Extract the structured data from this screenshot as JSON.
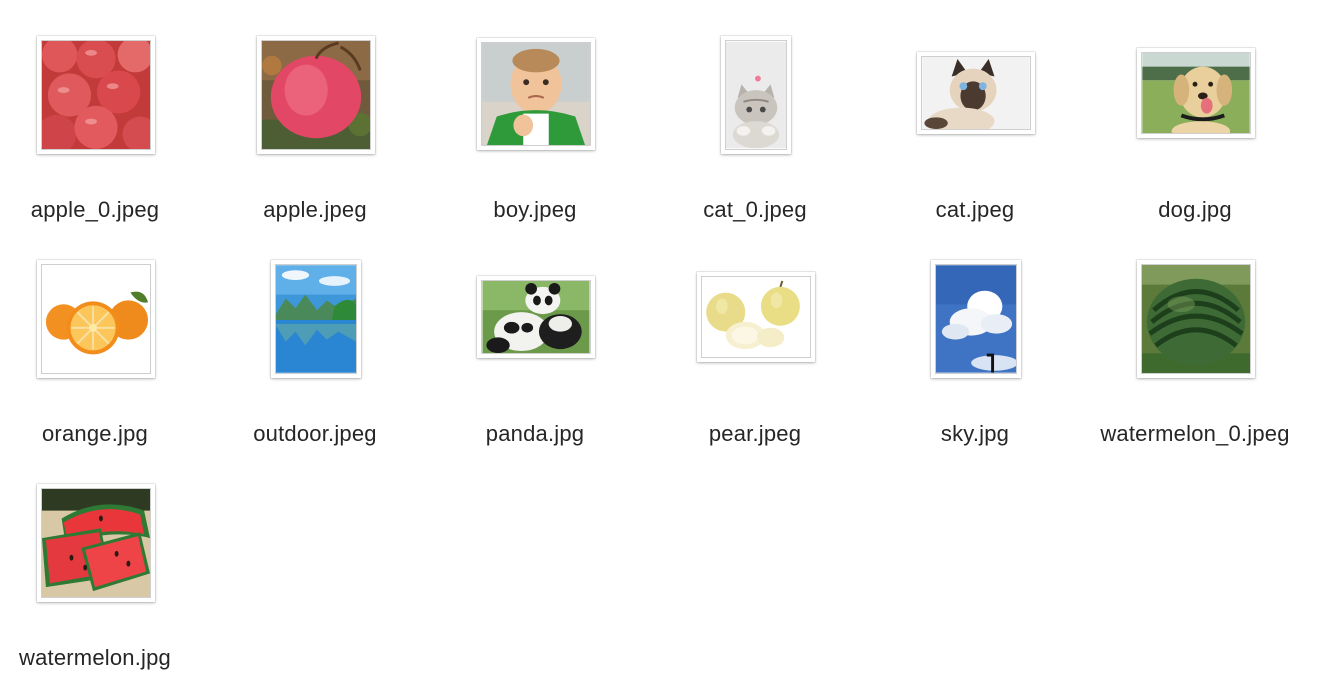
{
  "window": {
    "background": "#ffffff"
  },
  "files": [
    {
      "name": "apple_0.jpeg",
      "icon": "red-apples-thumbnail-icon"
    },
    {
      "name": "apple.jpeg",
      "icon": "apple-thumbnail-icon"
    },
    {
      "name": "boy.jpeg",
      "icon": "boy-thumbnail-icon"
    },
    {
      "name": "cat_0.jpeg",
      "icon": "kitten-thumbnail-icon"
    },
    {
      "name": "cat.jpeg",
      "icon": "siamese-cat-thumbnail-icon"
    },
    {
      "name": "dog.jpg",
      "icon": "dog-thumbnail-icon"
    },
    {
      "name": "orange.jpg",
      "icon": "oranges-thumbnail-icon"
    },
    {
      "name": "outdoor.jpeg",
      "icon": "landscape-thumbnail-icon"
    },
    {
      "name": "panda.jpg",
      "icon": "pandas-thumbnail-icon"
    },
    {
      "name": "pear.jpeg",
      "icon": "pears-thumbnail-icon"
    },
    {
      "name": "sky.jpg",
      "icon": "sky-thumbnail-icon"
    },
    {
      "name": "watermelon_0.jpeg",
      "icon": "watermelon-thumbnail-icon"
    },
    {
      "name": "watermelon.jpg",
      "icon": "watermelon-slices-thumbnail-icon"
    }
  ]
}
